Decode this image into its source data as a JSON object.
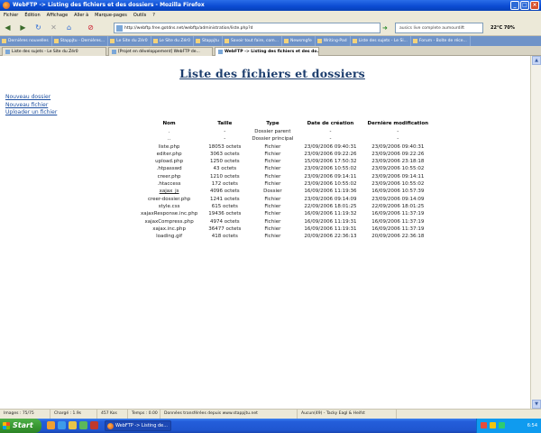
{
  "window": {
    "title": "WebFTP -> Listing des fichiers et des dossiers - Mozilla Firefox"
  },
  "menu": [
    "Fichier",
    "Édition",
    "Affichage",
    "Aller à",
    "Marque-pages",
    "Outils",
    "?"
  ],
  "nav": {
    "url": "http://webftp.free.gotdns.net/webftp/administration/liste.php?d",
    "search": "ausics live complete aumourdift",
    "weather": "22°C 70%"
  },
  "bookmarks": [
    "Dernières nouvelles",
    "Stappjtu - Dernières...",
    "Le Site du Zér0",
    "Le Site du Zér0",
    "Stappjtu",
    "Savoir tout faire, com...",
    "Newsmgfe",
    "Writing-Pad",
    "Liste des sujets - Le Si...",
    "Forum - Boîte de réce..."
  ],
  "tabs": [
    {
      "label": "Liste des sujets - Le Site du Zér0",
      "active": false
    },
    {
      "label": "[Projet en développement] WebFTP de...",
      "active": false
    },
    {
      "label": "WebFTP -> Listing des fichiers et des do...",
      "active": true
    }
  ],
  "page": {
    "title": "Liste des fichiers et dossiers",
    "actions": [
      "Nouveau dossier",
      "Nouveau fichier",
      "Uploader un fichier"
    ]
  },
  "table": {
    "headers": [
      "Nom",
      "Taille",
      "Type",
      "Date de création",
      "Dernière modification"
    ],
    "rows": [
      [
        ".",
        "-",
        "Dossier parent",
        "-",
        "-"
      ],
      [
        "..",
        "-",
        "Dossier principal",
        "-",
        "-"
      ],
      [
        "liste.php",
        "18053 octets",
        "Fichier",
        "23/09/2006 09:40:31",
        "23/09/2006 09:40:31"
      ],
      [
        "editer.php",
        "3063 octets",
        "Fichier",
        "23/09/2006 09:22:26",
        "23/09/2006 09:22:26"
      ],
      [
        "upload.php",
        "1250 octets",
        "Fichier",
        "15/09/2006 17:50:32",
        "23/09/2006 23:18:18"
      ],
      [
        ".htpasswd",
        "43 octets",
        "Fichier",
        "23/09/2006 10:55:02",
        "23/09/2006 10:55:02"
      ],
      [
        "creer.php",
        "1210 octets",
        "Fichier",
        "23/09/2006 09:14:11",
        "23/09/2006 09:14:11"
      ],
      [
        ".htaccess",
        "172 octets",
        "Fichier",
        "23/09/2006 10:55:02",
        "23/09/2006 10:55:02"
      ],
      [
        "xajax_js",
        "4096 octets",
        "Dossier",
        "16/09/2006 11:19:36",
        "16/09/2006 10:57:39"
      ],
      [
        "creer-dossier.php",
        "1241 octets",
        "Fichier",
        "23/09/2006 09:14:09",
        "23/09/2006 09:14:09"
      ],
      [
        "style.css",
        "615 octets",
        "Fichier",
        "22/09/2006 18:01:25",
        "22/09/2006 18:01:25"
      ],
      [
        "xajaxResponse.inc.php",
        "19436 octets",
        "Fichier",
        "16/09/2006 11:19:32",
        "16/09/2006 11:37:19"
      ],
      [
        "xajaxCompress.php",
        "4974 octets",
        "Fichier",
        "16/09/2006 11:19:31",
        "16/09/2006 11:37:19"
      ],
      [
        "xajax.inc.php",
        "36477 octets",
        "Fichier",
        "16/09/2006 11:19:31",
        "16/09/2006 11:37:19"
      ],
      [
        "loading.gif",
        "418 octets",
        "Fichier",
        "20/09/2006 22:36:13",
        "20/09/2006 22:36:18"
      ]
    ]
  },
  "statusbar": [
    "Images : 75/75",
    "Chargé : 1.9s",
    "457 Kos",
    "Temps : 0.00",
    "Données transférées depuis www.stappjtu.net",
    "Aucun(49) - Tacky Eagl & Heifst"
  ],
  "taskbar": {
    "start": "Start",
    "task": "WebFTP -> Listing de...",
    "clock": "6:54"
  }
}
